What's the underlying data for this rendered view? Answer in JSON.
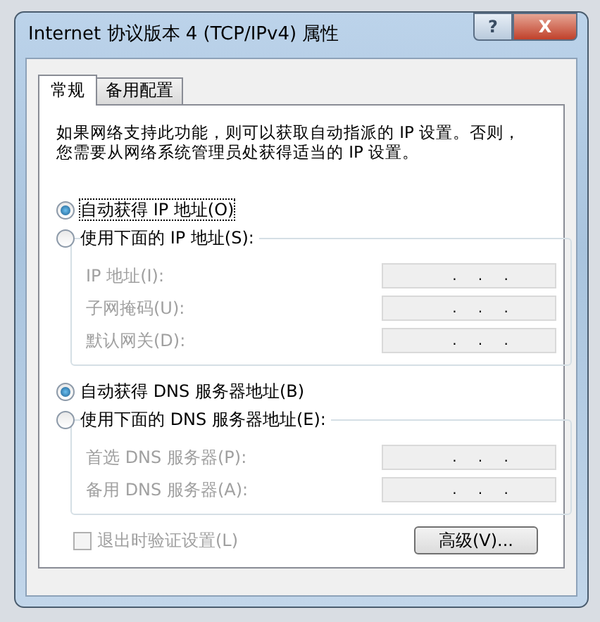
{
  "window": {
    "title": "Internet 协议版本 4 (TCP/IPv4) 属性",
    "buttons": [
      {
        "kind": "help",
        "label": "?"
      },
      {
        "kind": "close",
        "label": "X"
      }
    ]
  },
  "tabs": [
    {
      "label": "常规",
      "selected": true
    },
    {
      "label": "备用配置",
      "selected": false
    }
  ],
  "description_lines": [
    "如果网络支持此功能，则可以获取自动指派的 IP 设置。否则，",
    "您需要从网络系统管理员处获得适当的 IP 设置。"
  ],
  "sections": [
    {
      "options": [
        {
          "label": "自动获得 IP 地址(O)",
          "selected": true,
          "focused": true
        },
        {
          "label": "使用下面的 IP 地址(S):",
          "selected": false,
          "focused": false
        }
      ],
      "group": {
        "disabled": true,
        "fields": [
          {
            "label": "IP 地址(I):",
            "separators": [
              ".",
              ".",
              "."
            ]
          },
          {
            "label": "子网掩码(U):",
            "separators": [
              ".",
              ".",
              "."
            ]
          },
          {
            "label": "默认网关(D):",
            "separators": [
              ".",
              ".",
              "."
            ]
          }
        ]
      }
    },
    {
      "options": [
        {
          "label": "自动获得 DNS 服务器地址(B)",
          "selected": true,
          "focused": false
        },
        {
          "label": "使用下面的 DNS 服务器地址(E):",
          "selected": false,
          "focused": false
        }
      ],
      "group": {
        "disabled": true,
        "fields": [
          {
            "label": "首选 DNS 服务器(P):",
            "separators": [
              ".",
              ".",
              "."
            ]
          },
          {
            "label": "备用 DNS 服务器(A):",
            "separators": [
              ".",
              ".",
              "."
            ]
          }
        ]
      }
    }
  ],
  "validate_checkbox": {
    "label": "退出时验证设置(L)",
    "checked": false,
    "disabled": true
  },
  "advanced_button": {
    "label": "高级(V)..."
  }
}
